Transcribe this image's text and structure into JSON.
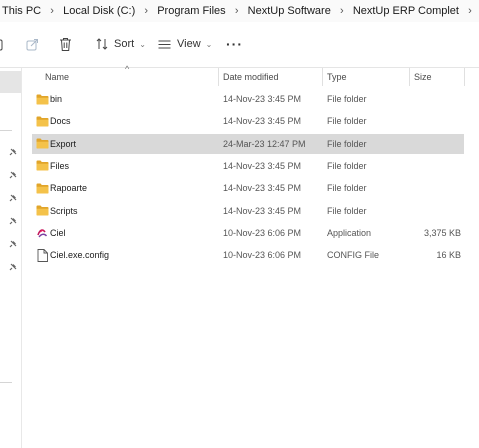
{
  "breadcrumb": {
    "items": [
      "This PC",
      "Local Disk (C:)",
      "Program Files",
      "NextUp Software",
      "NextUp ERP Complet"
    ]
  },
  "toolbar": {
    "sort_label": "Sort",
    "view_label": "View",
    "more_label": "···"
  },
  "columns": {
    "name": "Name",
    "date": "Date modified",
    "type": "Type",
    "size": "Size"
  },
  "files": [
    {
      "name": "bin",
      "date": "14-Nov-23 3:45 PM",
      "type": "File folder",
      "size": "",
      "icon": "folder-icon",
      "selected": false
    },
    {
      "name": "Docs",
      "date": "14-Nov-23 3:45 PM",
      "type": "File folder",
      "size": "",
      "icon": "folder-icon",
      "selected": false
    },
    {
      "name": "Export",
      "date": "24-Mar-23 12:47 PM",
      "type": "File folder",
      "size": "",
      "icon": "folder-icon",
      "selected": true
    },
    {
      "name": "Files",
      "date": "14-Nov-23 3:45 PM",
      "type": "File folder",
      "size": "",
      "icon": "folder-icon",
      "selected": false
    },
    {
      "name": "Rapoarte",
      "date": "14-Nov-23 3:45 PM",
      "type": "File folder",
      "size": "",
      "icon": "folder-icon",
      "selected": false
    },
    {
      "name": "Scripts",
      "date": "14-Nov-23 3:45 PM",
      "type": "File folder",
      "size": "",
      "icon": "folder-icon",
      "selected": false
    },
    {
      "name": "Ciel",
      "date": "10-Nov-23 6:06 PM",
      "type": "Application",
      "size": "3,375 KB",
      "icon": "ciel-app-icon",
      "selected": false
    },
    {
      "name": "Ciel.exe.config",
      "date": "10-Nov-23 6:06 PM",
      "type": "CONFIG File",
      "size": "16 KB",
      "icon": "config-file-icon",
      "selected": false
    }
  ],
  "colors": {
    "folder": "#f4c24a",
    "folder_back": "#e1a52a",
    "selected_row": "#d9d9d9",
    "accent": "#0067c0"
  }
}
